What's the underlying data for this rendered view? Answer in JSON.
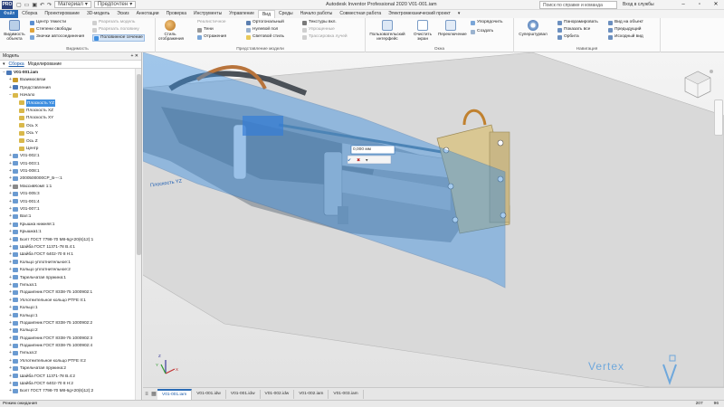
{
  "titlebar": {
    "logo": "PRO",
    "style_combo": "Материал",
    "appearance_combo": "Предпочтен",
    "title": "Autodesk Inventor Professional 2020    V01-001.iam",
    "search_placeholder": "Поиск по справке и команда",
    "signin": "Вход в службы"
  },
  "tabs": [
    "Файл",
    "Сборка",
    "Проектирование",
    "3D-модель",
    "Эскиз",
    "Аннотации",
    "Проверка",
    "Инструменты",
    "Управление",
    "Вид",
    "Среды",
    "Начало работы",
    "Совместная работа",
    "Электромеханический проект"
  ],
  "active_tab": "Вид",
  "ribbon": {
    "visibility": {
      "name": "Видимость",
      "big": "Видимость объекта",
      "items": [
        "Центр тяжести",
        "Степени свободы",
        "Значки автосоединения"
      ],
      "gray_items": [
        "Разрезать модель",
        "Разрезать половину",
        "Половинное сечение"
      ]
    },
    "appearance": {
      "name": "Представление модели",
      "styles": "Стиль отображения",
      "col1": [
        "Реалистичное",
        "Тени",
        "Отражения"
      ],
      "col2": [
        "Ортогональный",
        "Нулевой пол",
        "Световой стиль"
      ],
      "col3": [
        "Текстуры вкл.",
        "Упрощенные",
        "Трассировка лучей"
      ]
    },
    "windows": {
      "name": "Окна",
      "user_interface": "Пользовательский интерфейс",
      "clear_screen": "Очистить экран",
      "switch": "Переключение",
      "arrange": "Упорядочить",
      "new": "Создать"
    },
    "navigate": {
      "name": "Навигация",
      "fullnav": "Суперштурвал",
      "col1": [
        "Панорамировать",
        "Показать все",
        "Орбита"
      ],
      "col2": [
        "Вид на объект",
        "Предыдущий",
        "Исходный вид"
      ]
    }
  },
  "browser": {
    "title": "Модель",
    "tab_model": "Сборка",
    "tab_modeling": "Моделирование",
    "nodes": [
      {
        "label": "V01-001.iam",
        "indent": 0,
        "exp": "−",
        "icon": "assembly-icon",
        "color": "#4a78b8",
        "bold": true
      },
      {
        "label": "Взаимосвязи",
        "indent": 1,
        "exp": "+",
        "icon": "relationships-icon",
        "color": "#c89a2a"
      },
      {
        "label": "Представления",
        "indent": 1,
        "exp": "+",
        "icon": "representations-icon",
        "color": "#4a78b8"
      },
      {
        "label": "Начало",
        "indent": 1,
        "exp": "−",
        "icon": "folder-icon",
        "color": "#d9b84a"
      },
      {
        "label": "Плоскость YZ",
        "indent": 2,
        "exp": "",
        "icon": "plane-icon",
        "color": "#d9b84a",
        "selected": true
      },
      {
        "label": "Плоскость XZ",
        "indent": 2,
        "exp": "",
        "icon": "plane-icon",
        "color": "#d9b84a"
      },
      {
        "label": "Плоскость XY",
        "indent": 2,
        "exp": "",
        "icon": "plane-icon",
        "color": "#d9b84a"
      },
      {
        "label": "Ось X",
        "indent": 2,
        "exp": "",
        "icon": "axis-icon",
        "color": "#d9b84a"
      },
      {
        "label": "Ось Y",
        "indent": 2,
        "exp": "",
        "icon": "axis-icon",
        "color": "#d9b84a"
      },
      {
        "label": "Ось Z",
        "indent": 2,
        "exp": "",
        "icon": "axis-icon",
        "color": "#d9b84a"
      },
      {
        "label": "Центр",
        "indent": 2,
        "exp": "",
        "icon": "point-icon",
        "color": "#d9b84a"
      },
      {
        "label": "V01-002:1",
        "indent": 1,
        "exp": "+",
        "icon": "part-icon",
        "color": "#6b9bd1"
      },
      {
        "label": "V01-003:1",
        "indent": 1,
        "exp": "+",
        "icon": "part-icon",
        "color": "#6b9bd1"
      },
      {
        "label": "V01-008:1",
        "indent": 1,
        "exp": "+",
        "icon": "part-icon",
        "color": "#6b9bd1"
      },
      {
        "label": "2000500000СР_Б---:1",
        "indent": 1,
        "exp": "+",
        "icon": "part-icon",
        "color": "#6b9bd1"
      },
      {
        "label": "МассивКомп 1:1",
        "indent": 1,
        "exp": "+",
        "icon": "pattern-icon",
        "color": "#8a8a8a"
      },
      {
        "label": "V01-005:3",
        "indent": 1,
        "exp": "+",
        "icon": "part-icon",
        "color": "#6b9bd1"
      },
      {
        "label": "V01-001:4",
        "indent": 1,
        "exp": "+",
        "icon": "part-icon",
        "color": "#6b9bd1"
      },
      {
        "label": "V01-007:1",
        "indent": 1,
        "exp": "+",
        "icon": "part-icon",
        "color": "#6b9bd1"
      },
      {
        "label": "Вал:1",
        "indent": 1,
        "exp": "+",
        "icon": "part-icon",
        "color": "#6b9bd1"
      },
      {
        "label": "Крышка нижняя:1",
        "indent": 1,
        "exp": "+",
        "icon": "part-icon",
        "color": "#6b9bd1"
      },
      {
        "label": "Крышка1:1",
        "indent": 1,
        "exp": "+",
        "icon": "part-icon",
        "color": "#6b9bd1"
      },
      {
        "label": "Болт ГОСТ 7798-70 М8-6g×20(6)12):1",
        "indent": 1,
        "exp": "+",
        "icon": "part-icon",
        "color": "#6b9bd1"
      },
      {
        "label": "Шайба ГОСТ 11371-78 В.4:1",
        "indent": 1,
        "exp": "+",
        "icon": "part-icon",
        "color": "#6b9bd1"
      },
      {
        "label": "Шайба ГОСТ 6402-70 8 Н:1",
        "indent": 1,
        "exp": "+",
        "icon": "part-icon",
        "color": "#6b9bd1"
      },
      {
        "label": "Кольцо уплотнительное:1",
        "indent": 1,
        "exp": "+",
        "icon": "part-icon",
        "color": "#6b9bd1"
      },
      {
        "label": "Кольцо уплотнительное:2",
        "indent": 1,
        "exp": "+",
        "icon": "part-icon",
        "color": "#6b9bd1"
      },
      {
        "label": "Тарельчатая пружина:1",
        "indent": 1,
        "exp": "+",
        "icon": "part-icon",
        "color": "#6b9bd1"
      },
      {
        "label": "Гильза:1",
        "indent": 1,
        "exp": "+",
        "icon": "part-icon",
        "color": "#6b9bd1"
      },
      {
        "label": "Подшипник ГОСТ 8338-75 1000902:1",
        "indent": 1,
        "exp": "+",
        "icon": "part-icon",
        "color": "#6b9bd1"
      },
      {
        "label": "Уплотнительное кольцо PTFE II:1",
        "indent": 1,
        "exp": "+",
        "icon": "part-icon",
        "color": "#6b9bd1"
      },
      {
        "label": "Кольцо:1",
        "indent": 1,
        "exp": "+",
        "icon": "part-icon",
        "color": "#6b9bd1"
      },
      {
        "label": "Кольцо:1",
        "indent": 1,
        "exp": "+",
        "icon": "part-icon",
        "color": "#6b9bd1"
      },
      {
        "label": "Подшипник ГОСТ 8338-75 1000902:2",
        "indent": 1,
        "exp": "+",
        "icon": "part-icon",
        "color": "#6b9bd1"
      },
      {
        "label": "Кольцо:2",
        "indent": 1,
        "exp": "+",
        "icon": "part-icon",
        "color": "#6b9bd1"
      },
      {
        "label": "Подшипник ГОСТ 8338-75 1000902:3",
        "indent": 1,
        "exp": "+",
        "icon": "part-icon",
        "color": "#6b9bd1"
      },
      {
        "label": "Подшипник ГОСТ 8338-75 1000902:4",
        "indent": 1,
        "exp": "+",
        "icon": "part-icon",
        "color": "#6b9bd1"
      },
      {
        "label": "Гильза:2",
        "indent": 1,
        "exp": "+",
        "icon": "part-icon",
        "color": "#6b9bd1"
      },
      {
        "label": "Уплотнительное кольцо PTFE II:2",
        "indent": 1,
        "exp": "+",
        "icon": "part-icon",
        "color": "#6b9bd1"
      },
      {
        "label": "Тарельчатая пружина:2",
        "indent": 1,
        "exp": "+",
        "icon": "part-icon",
        "color": "#6b9bd1"
      },
      {
        "label": "Шайба ГОСТ 11371-78 В.4:2",
        "indent": 1,
        "exp": "+",
        "icon": "part-icon",
        "color": "#6b9bd1"
      },
      {
        "label": "Шайба ГОСТ 6402-70 8 Н:2",
        "indent": 1,
        "exp": "+",
        "icon": "part-icon",
        "color": "#6b9bd1"
      },
      {
        "label": "Болт ГОСТ 7798-70 М8-6g×20(6)12):2",
        "indent": 1,
        "exp": "+",
        "icon": "part-icon",
        "color": "#6b9bd1"
      }
    ]
  },
  "viewport": {
    "plane_label": "Плоскость YZ",
    "offset_value": "0,000 мм",
    "watermark": "Vertex",
    "plane_color": "#3b8fe0",
    "axis_labels": [
      "Z",
      "X",
      "Y"
    ]
  },
  "doc_tabs": [
    "V01-001.iam",
    "V01-001.idw",
    "V01-001.idw",
    "V01-002.idw",
    "V01-002.iam",
    "V01-003.iam"
  ],
  "active_doc_tab": "V01-001.iam",
  "status": {
    "text": "Режим ожидания",
    "count_a": "207",
    "count_b": "96"
  }
}
